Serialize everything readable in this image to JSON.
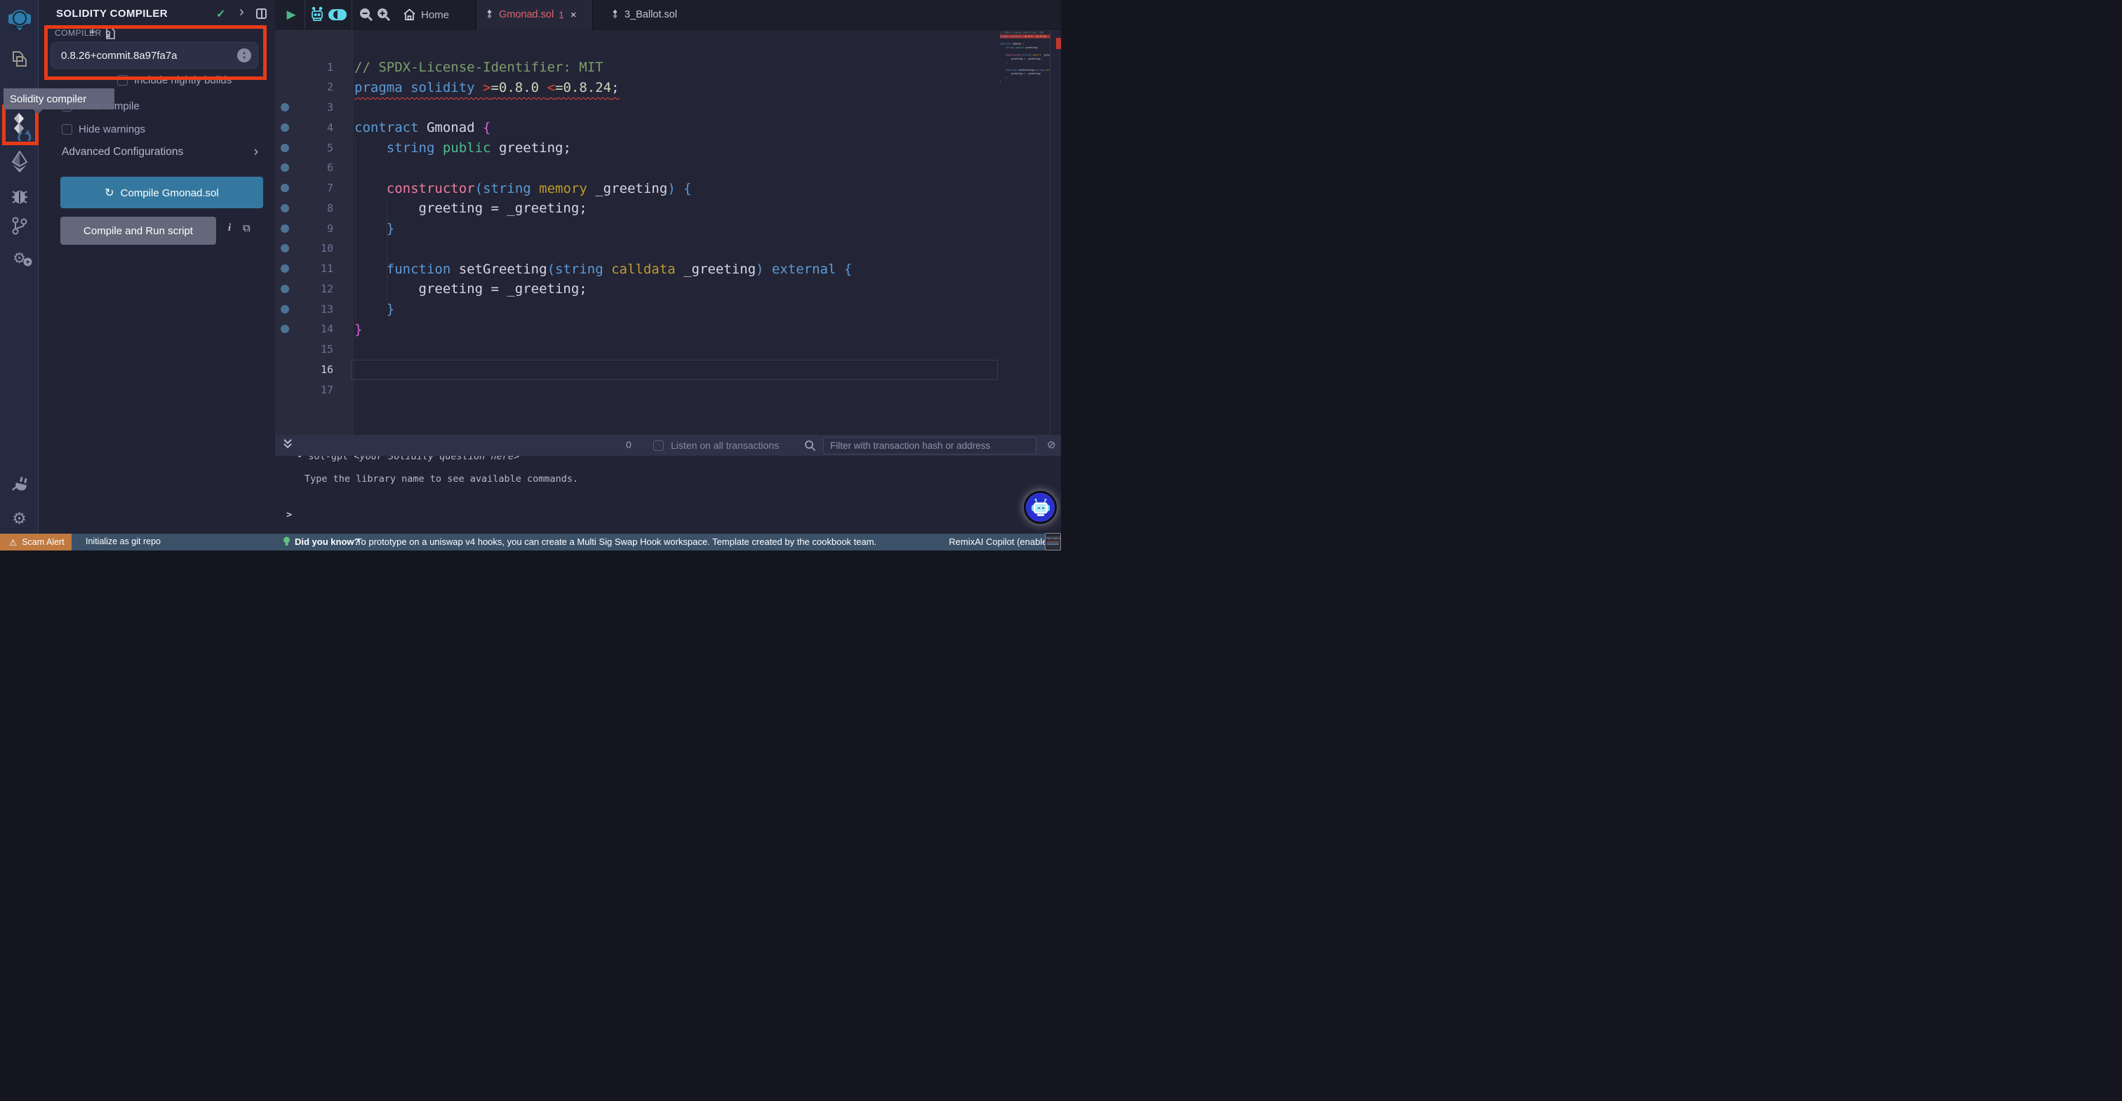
{
  "colors": {
    "highlight_red": "#e73b17",
    "compile_button_blue": "#35789f",
    "scam_orange": "#c0793f",
    "error_tab_salmon": "#e0646e",
    "accent_cyan": "#5fd8ea",
    "copilot_blue": "#2b2fd1",
    "statusbar_slate": "#3a5168"
  },
  "icons": {
    "check": "✓",
    "chevron_right": "›",
    "plus": "+",
    "close": "×",
    "play": "▶",
    "refresh": "↻",
    "copy": "⧉",
    "info": "i",
    "ban": "⊘",
    "warning": "⚠",
    "bullet": "•",
    "gear": "⚙"
  },
  "side_panel": {
    "title": "SOLIDITY COMPILER",
    "tooltip": "Solidity compiler",
    "compiler_section_label": "COMPILER",
    "compiler_version": "0.8.26+commit.8a97fa7a",
    "checkbox_nightly": "Include nightly builds",
    "checkbox_autocompile": "Auto compile",
    "checkbox_hide_warnings": "Hide warnings",
    "advanced_label": "Advanced Configurations",
    "compile_button_label": "Compile Gmonad.sol",
    "run_button_label": "Compile and Run script"
  },
  "tab_bar": {
    "home_label": "Home",
    "tabs": [
      {
        "label": "Gmonad.sol",
        "error_count": "1",
        "active": true
      },
      {
        "label": "3_Ballot.sol",
        "error_count": "",
        "active": false
      }
    ]
  },
  "editor": {
    "current_line": 16,
    "lines": [
      {
        "n": 1,
        "dot": false,
        "err": false,
        "tokens": [
          {
            "t": "// SPDX-License-Identifier: MIT",
            "c": "cm"
          }
        ]
      },
      {
        "n": 2,
        "dot": false,
        "err": true,
        "tokens": [
          {
            "t": "pragma solidity ",
            "c": "kw"
          },
          {
            "t": ">",
            "c": "op"
          },
          {
            "t": "=0.8.0 ",
            "c": "num"
          },
          {
            "t": "<",
            "c": "op"
          },
          {
            "t": "=0.8.24",
            "c": "num"
          },
          {
            "t": ";",
            "c": "fg"
          }
        ]
      },
      {
        "n": 3,
        "dot": true,
        "err": false,
        "tokens": []
      },
      {
        "n": 4,
        "dot": true,
        "err": false,
        "tokens": [
          {
            "t": "contract",
            "c": "kw"
          },
          {
            "t": " Gmonad ",
            "c": "fg"
          },
          {
            "t": "{",
            "c": "mag"
          }
        ]
      },
      {
        "n": 5,
        "dot": true,
        "err": false,
        "tokens": [
          {
            "t": "    ",
            "c": "fg"
          },
          {
            "t": "string",
            "c": "kw"
          },
          {
            "t": " ",
            "c": "fg"
          },
          {
            "t": "public",
            "c": "gr"
          },
          {
            "t": " greeting;",
            "c": "fg"
          }
        ]
      },
      {
        "n": 6,
        "dot": true,
        "err": false,
        "tokens": []
      },
      {
        "n": 7,
        "dot": true,
        "err": false,
        "tokens": [
          {
            "t": "    ",
            "c": "fg"
          },
          {
            "t": "constructor",
            "c": "pk"
          },
          {
            "t": "(",
            "c": "kw"
          },
          {
            "t": "string",
            "c": "kw"
          },
          {
            "t": " ",
            "c": "fg"
          },
          {
            "t": "memory",
            "c": "gd"
          },
          {
            "t": " _greeting",
            "c": "fg"
          },
          {
            "t": ") {",
            "c": "kw"
          }
        ]
      },
      {
        "n": 8,
        "dot": true,
        "err": false,
        "tokens": [
          {
            "t": "        greeting = _greeting;",
            "c": "fg"
          }
        ]
      },
      {
        "n": 9,
        "dot": true,
        "err": false,
        "tokens": [
          {
            "t": "    }",
            "c": "kw"
          }
        ]
      },
      {
        "n": 10,
        "dot": true,
        "err": false,
        "tokens": []
      },
      {
        "n": 11,
        "dot": true,
        "err": false,
        "tokens": [
          {
            "t": "    ",
            "c": "fg"
          },
          {
            "t": "function",
            "c": "kw"
          },
          {
            "t": " setGreeting",
            "c": "fg"
          },
          {
            "t": "(",
            "c": "kw"
          },
          {
            "t": "string",
            "c": "kw"
          },
          {
            "t": " ",
            "c": "fg"
          },
          {
            "t": "calldata",
            "c": "gd"
          },
          {
            "t": " _greeting",
            "c": "fg"
          },
          {
            "t": ") ",
            "c": "kw"
          },
          {
            "t": "external",
            "c": "kw"
          },
          {
            "t": " {",
            "c": "kw"
          }
        ]
      },
      {
        "n": 12,
        "dot": true,
        "err": false,
        "tokens": [
          {
            "t": "        greeting = _greeting;",
            "c": "fg"
          }
        ]
      },
      {
        "n": 13,
        "dot": true,
        "err": false,
        "tokens": [
          {
            "t": "    }",
            "c": "kw"
          }
        ]
      },
      {
        "n": 14,
        "dot": true,
        "err": false,
        "tokens": [
          {
            "t": "}",
            "c": "mag"
          }
        ]
      },
      {
        "n": 15,
        "dot": false,
        "err": false,
        "tokens": []
      },
      {
        "n": 16,
        "dot": false,
        "err": false,
        "tokens": []
      },
      {
        "n": 17,
        "dot": false,
        "err": false,
        "tokens": []
      }
    ]
  },
  "terminal": {
    "count": "0",
    "listen_label": "Listen on all transactions",
    "filter_placeholder": "Filter with transaction hash or address",
    "line1_bullet": "•",
    "line1_cmd": "sol-gpt ",
    "line1_arg": "<your Solidity question here>",
    "line2": "Type the library name to see available commands.",
    "prompt": ">"
  },
  "status_bar": {
    "scam_label": "Scam Alert",
    "git_label": "Initialize as git repo",
    "tip_label": "Did you know?",
    "tip_text": "To prototype on a uniswap v4 hooks, you can create a Multi Sig Swap Hook workspace. Template created by the cookbook team.",
    "copilot_label": "RemixAI Copilot (enabled)"
  },
  "thumbnail": {
    "label": "FILE EXPLORER"
  }
}
